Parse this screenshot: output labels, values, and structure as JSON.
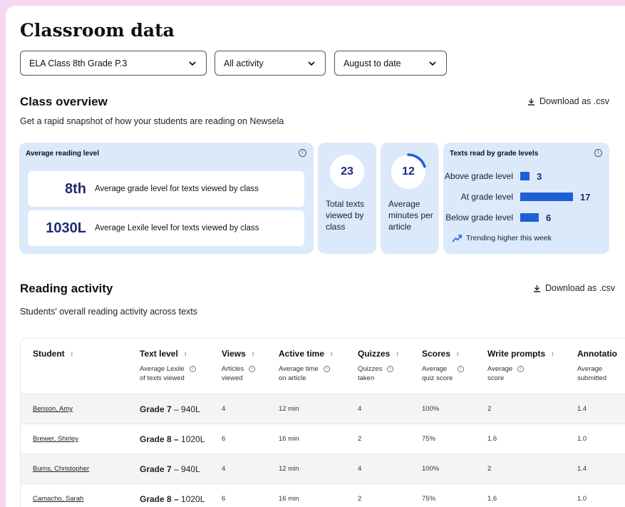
{
  "page": {
    "title": "Classroom data"
  },
  "filters": {
    "class_value": "ELA Class 8th Grade P.3",
    "activity_value": "All activity",
    "range_value": "August to date"
  },
  "overview": {
    "title": "Class overview",
    "subtitle": "Get a rapid snapshot of how your students are reading on Newsela",
    "download_label": "Download as .csv",
    "avg_reading": {
      "title": "Average reading level",
      "grade_value": "8th",
      "grade_label": "Average grade level for texts viewed by class",
      "lexile_value": "1030L",
      "lexile_label": "Average Lexile level for texts viewed by class"
    },
    "total_texts": {
      "value": "23",
      "label_line1": "Total texts",
      "label_line2": "viewed by",
      "label_line3": "class",
      "progress": 0.0
    },
    "avg_minutes": {
      "value": "12",
      "label_line1": "Average",
      "label_line2": "minutes per",
      "label_line3": "article",
      "progress": 0.2
    },
    "grade_levels": {
      "title": "Texts read by grade levels",
      "rows": [
        {
          "label": "Above grade level",
          "value": "3",
          "count": 3
        },
        {
          "label": "At grade level",
          "value": "17",
          "count": 17
        },
        {
          "label": "Below grade level",
          "value": "6",
          "count": 6
        }
      ],
      "trend_label": "Trending higher this week"
    }
  },
  "activity": {
    "title": "Reading activity",
    "subtitle": "Students' overall reading activity across texts",
    "download_label": "Download as .csv",
    "columns": [
      {
        "title": "Student",
        "sub1": "",
        "sub2": ""
      },
      {
        "title": "Text level",
        "sub1": "Average Lexile",
        "sub2": "of texts viewed"
      },
      {
        "title": "Views",
        "sub1": "Articles",
        "sub2": "viewed"
      },
      {
        "title": "Active time",
        "sub1": "Average time",
        "sub2": "on article"
      },
      {
        "title": "Quizzes",
        "sub1": "Quizzes",
        "sub2": "taken"
      },
      {
        "title": "Scores",
        "sub1": "Average",
        "sub2": "quiz score"
      },
      {
        "title": "Write prompts",
        "sub1": "Average",
        "sub2": "score"
      },
      {
        "title": "Annotatio",
        "sub1": "Average",
        "sub2": "submitted"
      }
    ],
    "rows": [
      {
        "name": "Benson, Amy",
        "grade": "Grade 7",
        "lexile": " – 940L",
        "views": "4",
        "time": "12 min",
        "quizzes": "4",
        "score": "100%",
        "write": "2",
        "annot": "1.4"
      },
      {
        "name": "Brewer, Shirley",
        "grade": "Grade 8 –",
        "lexile": " 1020L",
        "views": "6",
        "time": "16 min",
        "quizzes": "2",
        "score": "75%",
        "write": "1.6",
        "annot": "1.0"
      },
      {
        "name": "Burns, Christopher",
        "grade": "Grade 7",
        "lexile": " – 940L",
        "views": "4",
        "time": "12 min",
        "quizzes": "4",
        "score": "100%",
        "write": "2",
        "annot": "1.4"
      },
      {
        "name": "Camacho, Sarah",
        "grade": "Grade 8 –",
        "lexile": " 1020L",
        "views": "6",
        "time": "16 min",
        "quizzes": "2",
        "score": "75%",
        "write": "1.6",
        "annot": "1.0"
      }
    ]
  },
  "colors": {
    "accent": "#1f5fd6",
    "card_bg": "#dbe9fb",
    "navy": "#1e2a78",
    "outer_bg": "#f6d9f0"
  },
  "icons": {
    "chevron": "chevron-down-icon",
    "download": "download-icon",
    "info": "info-icon",
    "sort": "sort-icon",
    "trend": "trending-up-icon"
  }
}
